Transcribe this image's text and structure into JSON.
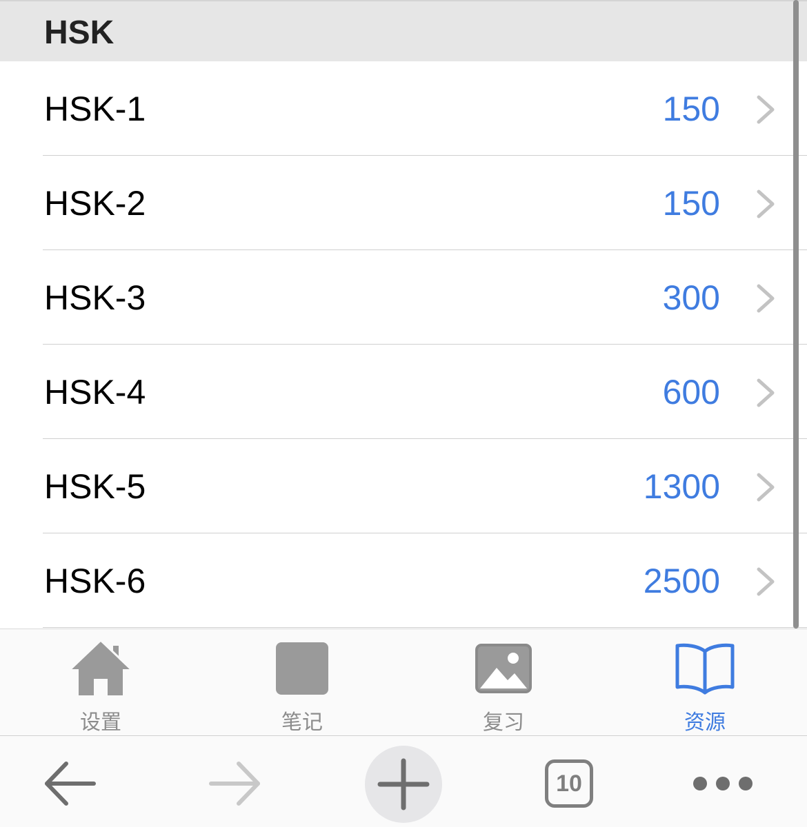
{
  "section": {
    "title": "HSK"
  },
  "rows": [
    {
      "label": "HSK-1",
      "count": "150"
    },
    {
      "label": "HSK-2",
      "count": "150"
    },
    {
      "label": "HSK-3",
      "count": "300"
    },
    {
      "label": "HSK-4",
      "count": "600"
    },
    {
      "label": "HSK-5",
      "count": "1300"
    },
    {
      "label": "HSK-6",
      "count": "2500"
    }
  ],
  "tabbar": {
    "tabs": [
      {
        "label": "设置",
        "icon": "home-icon",
        "active": false
      },
      {
        "label": "笔记",
        "icon": "square-icon",
        "active": false
      },
      {
        "label": "复习",
        "icon": "image-icon",
        "active": false
      },
      {
        "label": "资源",
        "icon": "book-icon",
        "active": true
      }
    ]
  },
  "browser": {
    "tab_count": "10",
    "buttons": [
      "back-arrow-icon",
      "forward-arrow-icon",
      "plus-icon",
      "tabs-icon",
      "more-icon"
    ]
  },
  "colors": {
    "accent": "#3f7ce0",
    "inactive": "#8c8c8c",
    "header_bg": "#e6e6e6"
  }
}
